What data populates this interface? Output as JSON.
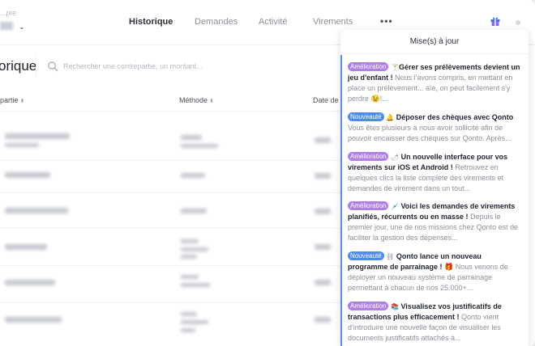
{
  "account": {
    "label": "...pte",
    "chevron": "⌄"
  },
  "nav": {
    "items": [
      {
        "label": "Historique",
        "active": true
      },
      {
        "label": "Demandes",
        "active": false
      },
      {
        "label": "Activité",
        "active": false
      },
      {
        "label": "Virements",
        "active": false
      }
    ],
    "more_label": "•••",
    "icons": [
      "gift-icon",
      "dot-icon"
    ]
  },
  "page": {
    "title": "orique",
    "search_placeholder": "Rechercher une contrepartie, un montant..."
  },
  "table": {
    "columns": [
      {
        "label": "partie",
        "sort": "⬍"
      },
      {
        "label": "Méthode",
        "sort": "⬍"
      },
      {
        "label": "Date de",
        "sort": ""
      }
    ]
  },
  "panel": {
    "title": "Mise(s) à jour",
    "accent": "#5a8ff0",
    "badge_colors": {
      "Amélioration": "#b07fe6",
      "Nouveauté": "#4f8bee"
    },
    "items": [
      {
        "badge": "Amélioration",
        "emoji": "🍸",
        "title": "Gérer ses prélèvements devient un jeu d'enfant !",
        "text": " Nous l'avons compris, en mettant en place un prélèvement... aïe, on peut facilement s'y perdre 😉!..."
      },
      {
        "badge": "Nouveauté",
        "emoji": "🔔",
        "title": "Déposer des chèques avec Qonto",
        "text": "Vous êtes plusieurs à nous avoir sollicité afin de pouvoir encaisser des chèques sur Qonto. Après..."
      },
      {
        "badge": "Amélioration",
        "emoji": "🌶",
        "title": "Un nouvelle interface pour vos virements sur iOS et Android !",
        "text": " Retrouvez en quelques clics la liste complète des virements et demandes de virement dans un tout..."
      },
      {
        "badge": "Amélioration",
        "emoji": "💉",
        "title": "Voici les demandes de virements planifiés, récurrents ou en masse !",
        "text": " Depuis le premier jour, une de nos missions chez Qonto est de faciliter la gestion des dépenses..."
      },
      {
        "badge": "Nouveauté",
        "emoji": "⛓",
        "title": "Qonto lance un nouveau programme de parrainage !",
        "text": " 🎁 Nous venons de déployer un nouveau système de parrainage permettant à chacun de nos 25.000+..."
      },
      {
        "badge": "Amélioration",
        "emoji": "📚",
        "title": "Visualisez vos justificatifs de transactions plus efficacement !",
        "text": " Qonto vient d'introduire une nouvelle façon de visualiser les documents justificatifs attachés à..."
      }
    ]
  }
}
